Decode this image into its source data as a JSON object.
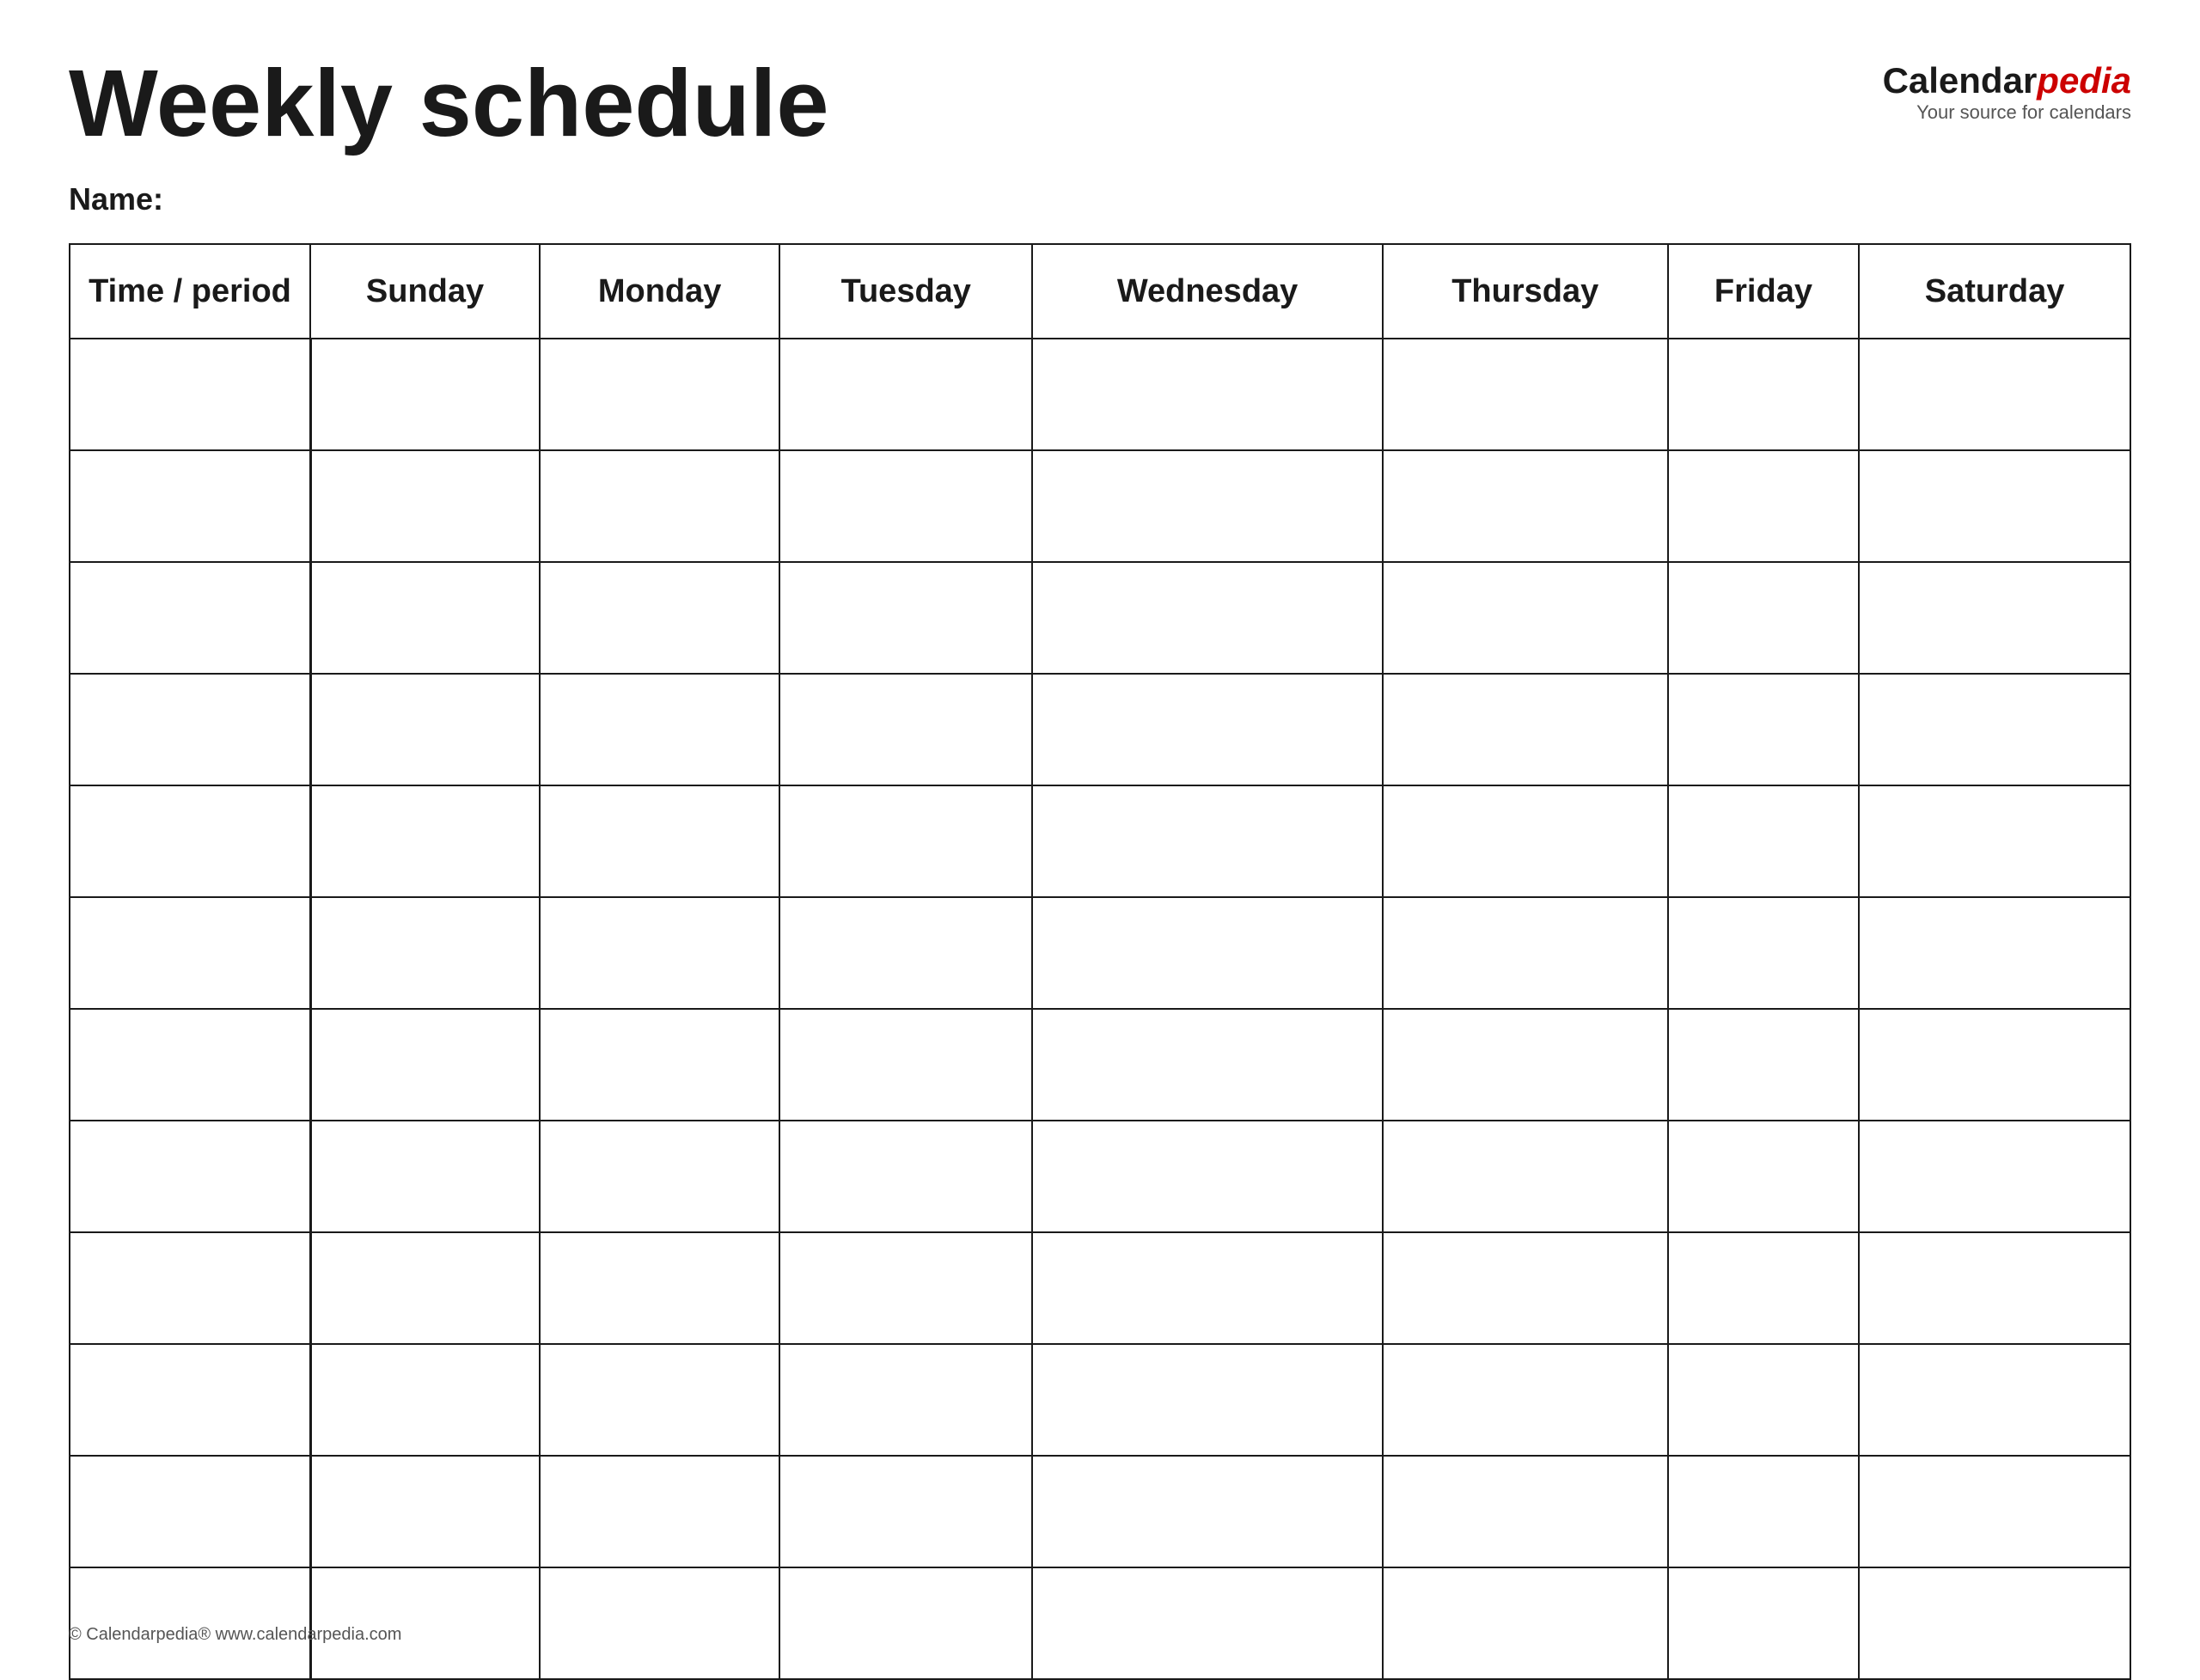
{
  "header": {
    "title": "Weekly schedule",
    "logo": {
      "calendar_text": "Calendar",
      "pedia_text": "pedia",
      "subtitle": "Your source for calendars"
    }
  },
  "name_label": "Name:",
  "table": {
    "columns": [
      {
        "id": "time",
        "label": "Time / period"
      },
      {
        "id": "sunday",
        "label": "Sunday"
      },
      {
        "id": "monday",
        "label": "Monday"
      },
      {
        "id": "tuesday",
        "label": "Tuesday"
      },
      {
        "id": "wednesday",
        "label": "Wednesday"
      },
      {
        "id": "thursday",
        "label": "Thursday"
      },
      {
        "id": "friday",
        "label": "Friday"
      },
      {
        "id": "saturday",
        "label": "Saturday"
      }
    ],
    "row_count": 12
  },
  "footer": {
    "text": "© Calendarpedia®  www.calendarpedia.com"
  }
}
